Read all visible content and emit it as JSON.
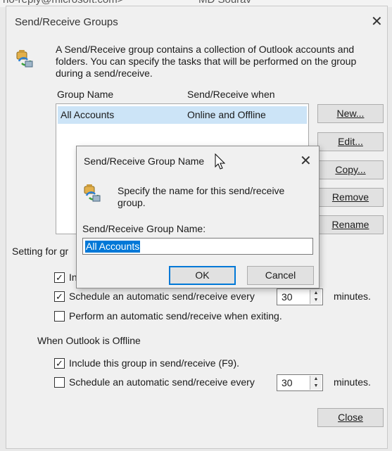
{
  "background": {
    "email_partial": "no-reply@microsoft.com>",
    "name_partial": "MD Sourav"
  },
  "main_dialog": {
    "title": "Send/Receive Groups",
    "description_lines": [
      "A Send/Receive group contains a collection of Outlook accounts and",
      "folders. You can specify the tasks that will be performed on the group",
      "during a send/receive."
    ],
    "columns": {
      "group_name": "Group Name",
      "when": "Send/Receive when"
    },
    "groups": [
      {
        "name": "All Accounts",
        "when": "Online and Offline",
        "selected": true
      }
    ],
    "buttons": {
      "new": "New...",
      "edit": "Edit...",
      "copy": "Copy...",
      "remove": "Remove",
      "rename": "Rename",
      "close": "Close"
    },
    "setting_label_partial": "Setting for gr",
    "online": {
      "include_partial": "In",
      "schedule": "Schedule an automatic send/receive every",
      "schedule_value": "30",
      "schedule_unit": "minutes.",
      "on_exit": "Perform an automatic send/receive when exiting.",
      "include_checked": true,
      "schedule_checked": true,
      "on_exit_checked": false
    },
    "offline": {
      "heading": "When Outlook is Offline",
      "include": "Include this group in send/receive (F9).",
      "include_checked": true,
      "schedule": "Schedule an automatic send/receive every",
      "schedule_value": "30",
      "schedule_unit": "minutes.",
      "schedule_checked": false
    }
  },
  "name_dialog": {
    "title": "Send/Receive Group Name",
    "instruction_lines": [
      "Specify the name for this send/receive",
      "group."
    ],
    "field_label": "Send/Receive Group Name:",
    "field_value": "All Accounts",
    "ok": "OK",
    "cancel": "Cancel"
  },
  "colors": {
    "selection": "#cce4f7",
    "text_highlight": "#0078d7",
    "button_face": "#e1e1e1",
    "default_button_border": "#0078d7"
  },
  "icons": [
    "send-receive-group-icon",
    "close-icon",
    "checkbox-icon",
    "spin-arrows-icon",
    "mouse-pointer-icon"
  ]
}
